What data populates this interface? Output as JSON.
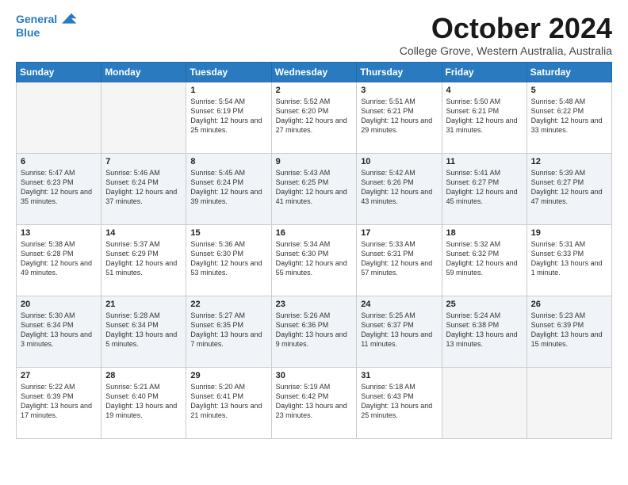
{
  "logo": {
    "line1": "General",
    "line2": "Blue"
  },
  "title": "October 2024",
  "subtitle": "College Grove, Western Australia, Australia",
  "days_of_week": [
    "Sunday",
    "Monday",
    "Tuesday",
    "Wednesday",
    "Thursday",
    "Friday",
    "Saturday"
  ],
  "weeks": [
    [
      {
        "day": "",
        "info": ""
      },
      {
        "day": "",
        "info": ""
      },
      {
        "day": "1",
        "info": "Sunrise: 5:54 AM\nSunset: 6:19 PM\nDaylight: 12 hours and 25 minutes."
      },
      {
        "day": "2",
        "info": "Sunrise: 5:52 AM\nSunset: 6:20 PM\nDaylight: 12 hours and 27 minutes."
      },
      {
        "day": "3",
        "info": "Sunrise: 5:51 AM\nSunset: 6:21 PM\nDaylight: 12 hours and 29 minutes."
      },
      {
        "day": "4",
        "info": "Sunrise: 5:50 AM\nSunset: 6:21 PM\nDaylight: 12 hours and 31 minutes."
      },
      {
        "day": "5",
        "info": "Sunrise: 5:48 AM\nSunset: 6:22 PM\nDaylight: 12 hours and 33 minutes."
      }
    ],
    [
      {
        "day": "6",
        "info": "Sunrise: 5:47 AM\nSunset: 6:23 PM\nDaylight: 12 hours and 35 minutes."
      },
      {
        "day": "7",
        "info": "Sunrise: 5:46 AM\nSunset: 6:24 PM\nDaylight: 12 hours and 37 minutes."
      },
      {
        "day": "8",
        "info": "Sunrise: 5:45 AM\nSunset: 6:24 PM\nDaylight: 12 hours and 39 minutes."
      },
      {
        "day": "9",
        "info": "Sunrise: 5:43 AM\nSunset: 6:25 PM\nDaylight: 12 hours and 41 minutes."
      },
      {
        "day": "10",
        "info": "Sunrise: 5:42 AM\nSunset: 6:26 PM\nDaylight: 12 hours and 43 minutes."
      },
      {
        "day": "11",
        "info": "Sunrise: 5:41 AM\nSunset: 6:27 PM\nDaylight: 12 hours and 45 minutes."
      },
      {
        "day": "12",
        "info": "Sunrise: 5:39 AM\nSunset: 6:27 PM\nDaylight: 12 hours and 47 minutes."
      }
    ],
    [
      {
        "day": "13",
        "info": "Sunrise: 5:38 AM\nSunset: 6:28 PM\nDaylight: 12 hours and 49 minutes."
      },
      {
        "day": "14",
        "info": "Sunrise: 5:37 AM\nSunset: 6:29 PM\nDaylight: 12 hours and 51 minutes."
      },
      {
        "day": "15",
        "info": "Sunrise: 5:36 AM\nSunset: 6:30 PM\nDaylight: 12 hours and 53 minutes."
      },
      {
        "day": "16",
        "info": "Sunrise: 5:34 AM\nSunset: 6:30 PM\nDaylight: 12 hours and 55 minutes."
      },
      {
        "day": "17",
        "info": "Sunrise: 5:33 AM\nSunset: 6:31 PM\nDaylight: 12 hours and 57 minutes."
      },
      {
        "day": "18",
        "info": "Sunrise: 5:32 AM\nSunset: 6:32 PM\nDaylight: 12 hours and 59 minutes."
      },
      {
        "day": "19",
        "info": "Sunrise: 5:31 AM\nSunset: 6:33 PM\nDaylight: 13 hours and 1 minute."
      }
    ],
    [
      {
        "day": "20",
        "info": "Sunrise: 5:30 AM\nSunset: 6:34 PM\nDaylight: 13 hours and 3 minutes."
      },
      {
        "day": "21",
        "info": "Sunrise: 5:28 AM\nSunset: 6:34 PM\nDaylight: 13 hours and 5 minutes."
      },
      {
        "day": "22",
        "info": "Sunrise: 5:27 AM\nSunset: 6:35 PM\nDaylight: 13 hours and 7 minutes."
      },
      {
        "day": "23",
        "info": "Sunrise: 5:26 AM\nSunset: 6:36 PM\nDaylight: 13 hours and 9 minutes."
      },
      {
        "day": "24",
        "info": "Sunrise: 5:25 AM\nSunset: 6:37 PM\nDaylight: 13 hours and 11 minutes."
      },
      {
        "day": "25",
        "info": "Sunrise: 5:24 AM\nSunset: 6:38 PM\nDaylight: 13 hours and 13 minutes."
      },
      {
        "day": "26",
        "info": "Sunrise: 5:23 AM\nSunset: 6:39 PM\nDaylight: 13 hours and 15 minutes."
      }
    ],
    [
      {
        "day": "27",
        "info": "Sunrise: 5:22 AM\nSunset: 6:39 PM\nDaylight: 13 hours and 17 minutes."
      },
      {
        "day": "28",
        "info": "Sunrise: 5:21 AM\nSunset: 6:40 PM\nDaylight: 13 hours and 19 minutes."
      },
      {
        "day": "29",
        "info": "Sunrise: 5:20 AM\nSunset: 6:41 PM\nDaylight: 13 hours and 21 minutes."
      },
      {
        "day": "30",
        "info": "Sunrise: 5:19 AM\nSunset: 6:42 PM\nDaylight: 13 hours and 23 minutes."
      },
      {
        "day": "31",
        "info": "Sunrise: 5:18 AM\nSunset: 6:43 PM\nDaylight: 13 hours and 25 minutes."
      },
      {
        "day": "",
        "info": ""
      },
      {
        "day": "",
        "info": ""
      }
    ]
  ]
}
